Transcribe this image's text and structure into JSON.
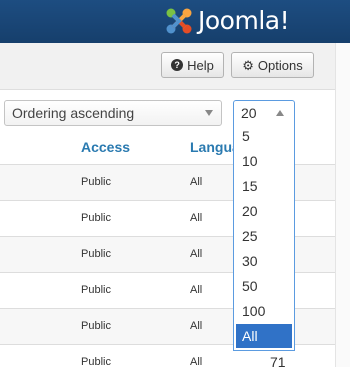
{
  "header": {
    "brand": "Joomla!",
    "logo_icon": "joomla-logo-icon",
    "colors": {
      "bar": "#1d4d81",
      "logo_red": "#e44d26",
      "logo_orange": "#f9a541",
      "logo_green": "#7ac143",
      "logo_blue": "#5091cd"
    }
  },
  "toolbar": {
    "help_label": "Help",
    "options_label": "Options"
  },
  "filters": {
    "ordering_value": "Ordering ascending",
    "limit_value": "20"
  },
  "table": {
    "columns": {
      "access": "Access",
      "language": "Language"
    },
    "rows": [
      {
        "access": "Public",
        "language": "All"
      },
      {
        "access": "Public",
        "language": "All"
      },
      {
        "access": "Public",
        "language": "All"
      },
      {
        "access": "Public",
        "language": "All"
      },
      {
        "access": "Public",
        "language": "All"
      },
      {
        "access": "Public",
        "language": "All",
        "id": "71"
      }
    ]
  },
  "limit_options": [
    "5",
    "10",
    "15",
    "20",
    "25",
    "30",
    "50",
    "100",
    "All"
  ],
  "limit_selected": "All",
  "accent": "#3072c7"
}
